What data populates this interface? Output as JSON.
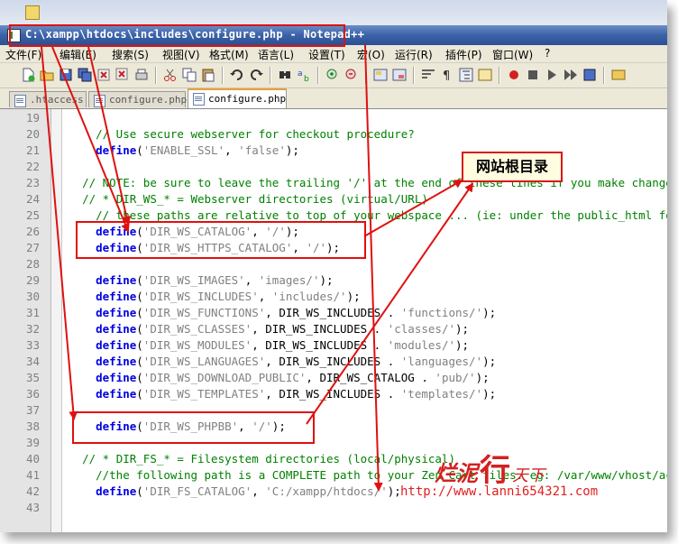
{
  "window": {
    "title": "C:\\xampp\\htdocs\\includes\\configure.php - Notepad++"
  },
  "menu": [
    "文件(F)",
    "编辑(E)",
    "搜索(S)",
    "视图(V)",
    "格式(M)",
    "语言(L)",
    "设置(T)",
    "宏(O)",
    "运行(R)",
    "插件(P)",
    "窗口(W)",
    "?"
  ],
  "tabs": [
    {
      "label": ".htaccess",
      "active": false
    },
    {
      "label": "configure.php",
      "active": false
    },
    {
      "label": "configure.php",
      "active": true
    }
  ],
  "editor": {
    "lines": [
      {
        "n": "19",
        "code": ""
      },
      {
        "n": "20",
        "code": "    // Use secure webserver for checkout procedure?"
      },
      {
        "n": "21",
        "code": "    define('ENABLE_SSL', 'false');"
      },
      {
        "n": "22",
        "code": ""
      },
      {
        "n": "23",
        "code": "  // NOTE: be sure to leave the trailing '/' at the end of these lines if you make changes!"
      },
      {
        "n": "24",
        "code": "  // * DIR_WS_* = Webserver directories (virtual/URL)"
      },
      {
        "n": "25",
        "code": "    // these paths are relative to top of your webspace ... (ie: under the public_html folder)"
      },
      {
        "n": "26",
        "code": "    define('DIR_WS_CATALOG', '/');"
      },
      {
        "n": "27",
        "code": "    define('DIR_WS_HTTPS_CATALOG', '/');"
      },
      {
        "n": "28",
        "code": ""
      },
      {
        "n": "29",
        "code": "    define('DIR_WS_IMAGES', 'images/');"
      },
      {
        "n": "30",
        "code": "    define('DIR_WS_INCLUDES', 'includes/');"
      },
      {
        "n": "31",
        "code": "    define('DIR_WS_FUNCTIONS', DIR_WS_INCLUDES . 'functions/');"
      },
      {
        "n": "32",
        "code": "    define('DIR_WS_CLASSES', DIR_WS_INCLUDES . 'classes/');"
      },
      {
        "n": "33",
        "code": "    define('DIR_WS_MODULES', DIR_WS_INCLUDES . 'modules/');"
      },
      {
        "n": "34",
        "code": "    define('DIR_WS_LANGUAGES', DIR_WS_INCLUDES . 'languages/');"
      },
      {
        "n": "35",
        "code": "    define('DIR_WS_DOWNLOAD_PUBLIC', DIR_WS_CATALOG . 'pub/');"
      },
      {
        "n": "36",
        "code": "    define('DIR_WS_TEMPLATES', DIR_WS_INCLUDES . 'templates/');"
      },
      {
        "n": "37",
        "code": ""
      },
      {
        "n": "38",
        "code": "    define('DIR_WS_PHPBB', '/');"
      },
      {
        "n": "39",
        "code": ""
      },
      {
        "n": "40",
        "code": "  // * DIR_FS_* = Filesystem directories (local/physical)"
      },
      {
        "n": "41",
        "code": "    //the following path is a COMPLETE path to your Zen Cart files. eg: /var/www/vhost/accountname/public_html/store/"
      },
      {
        "n": "42",
        "code": "    define('DIR_FS_CATALOG', 'C:/xampp/htdocs/');"
      },
      {
        "n": "43",
        "code": ""
      }
    ]
  },
  "annotation": {
    "callout": "网站根目录",
    "accent": "#e01010"
  },
  "watermark": {
    "part1": "烂泥",
    "part2": "行",
    "part3": "天下",
    "url": "http://www.lanni654321.com"
  }
}
